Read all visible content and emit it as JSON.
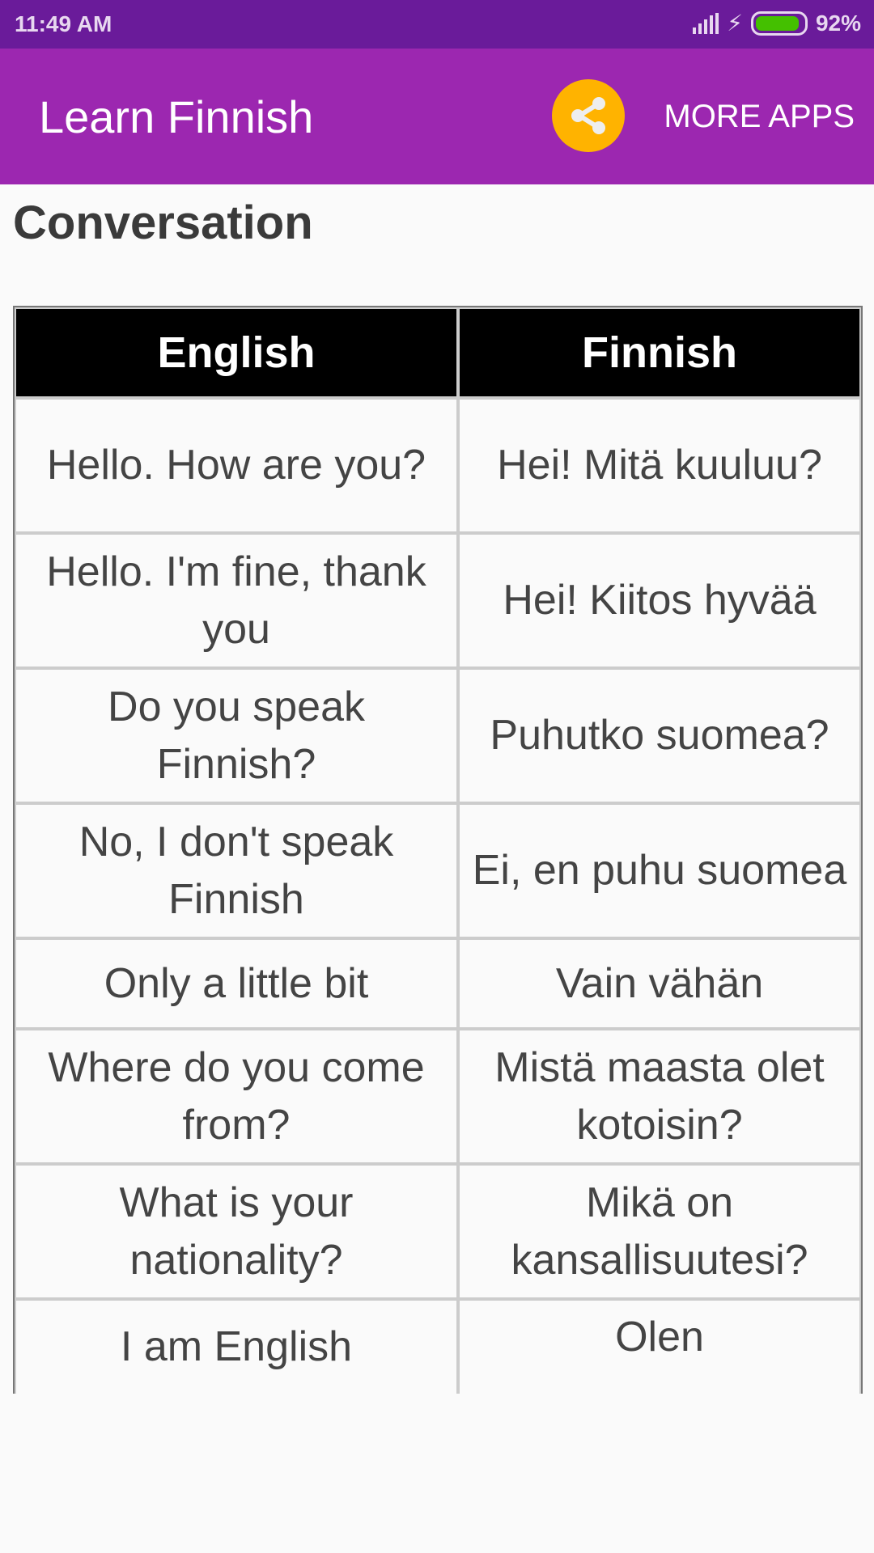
{
  "status_bar": {
    "time": "11:49 AM",
    "battery": "92%",
    "battery_level": 0.92
  },
  "app_bar": {
    "title": "Learn Finnish",
    "share_icon": "share-icon",
    "more_apps": "MORE APPS",
    "colors": {
      "primary": "#9c27b0",
      "status": "#6a1b9a",
      "share": "#ffb300"
    }
  },
  "section_title": "Conversation",
  "table": {
    "headers": [
      "English",
      "Finnish"
    ],
    "rows": [
      [
        "Hello. How are you?",
        "Hei! Mitä kuuluu?"
      ],
      [
        "Hello. I'm fine, thank you",
        "Hei! Kiitos hyvää"
      ],
      [
        "Do you speak Finnish?",
        "Puhutko suomea?"
      ],
      [
        "No, I don't speak Finnish",
        "Ei, en puhu suomea"
      ],
      [
        "Only a little bit",
        "Vain vähän"
      ],
      [
        "Where do you come from?",
        "Mistä maasta olet kotoisin?"
      ],
      [
        "What is your nationality?",
        "Mikä on kansallisuutesi?"
      ],
      [
        "I am English",
        "Olen"
      ]
    ]
  }
}
